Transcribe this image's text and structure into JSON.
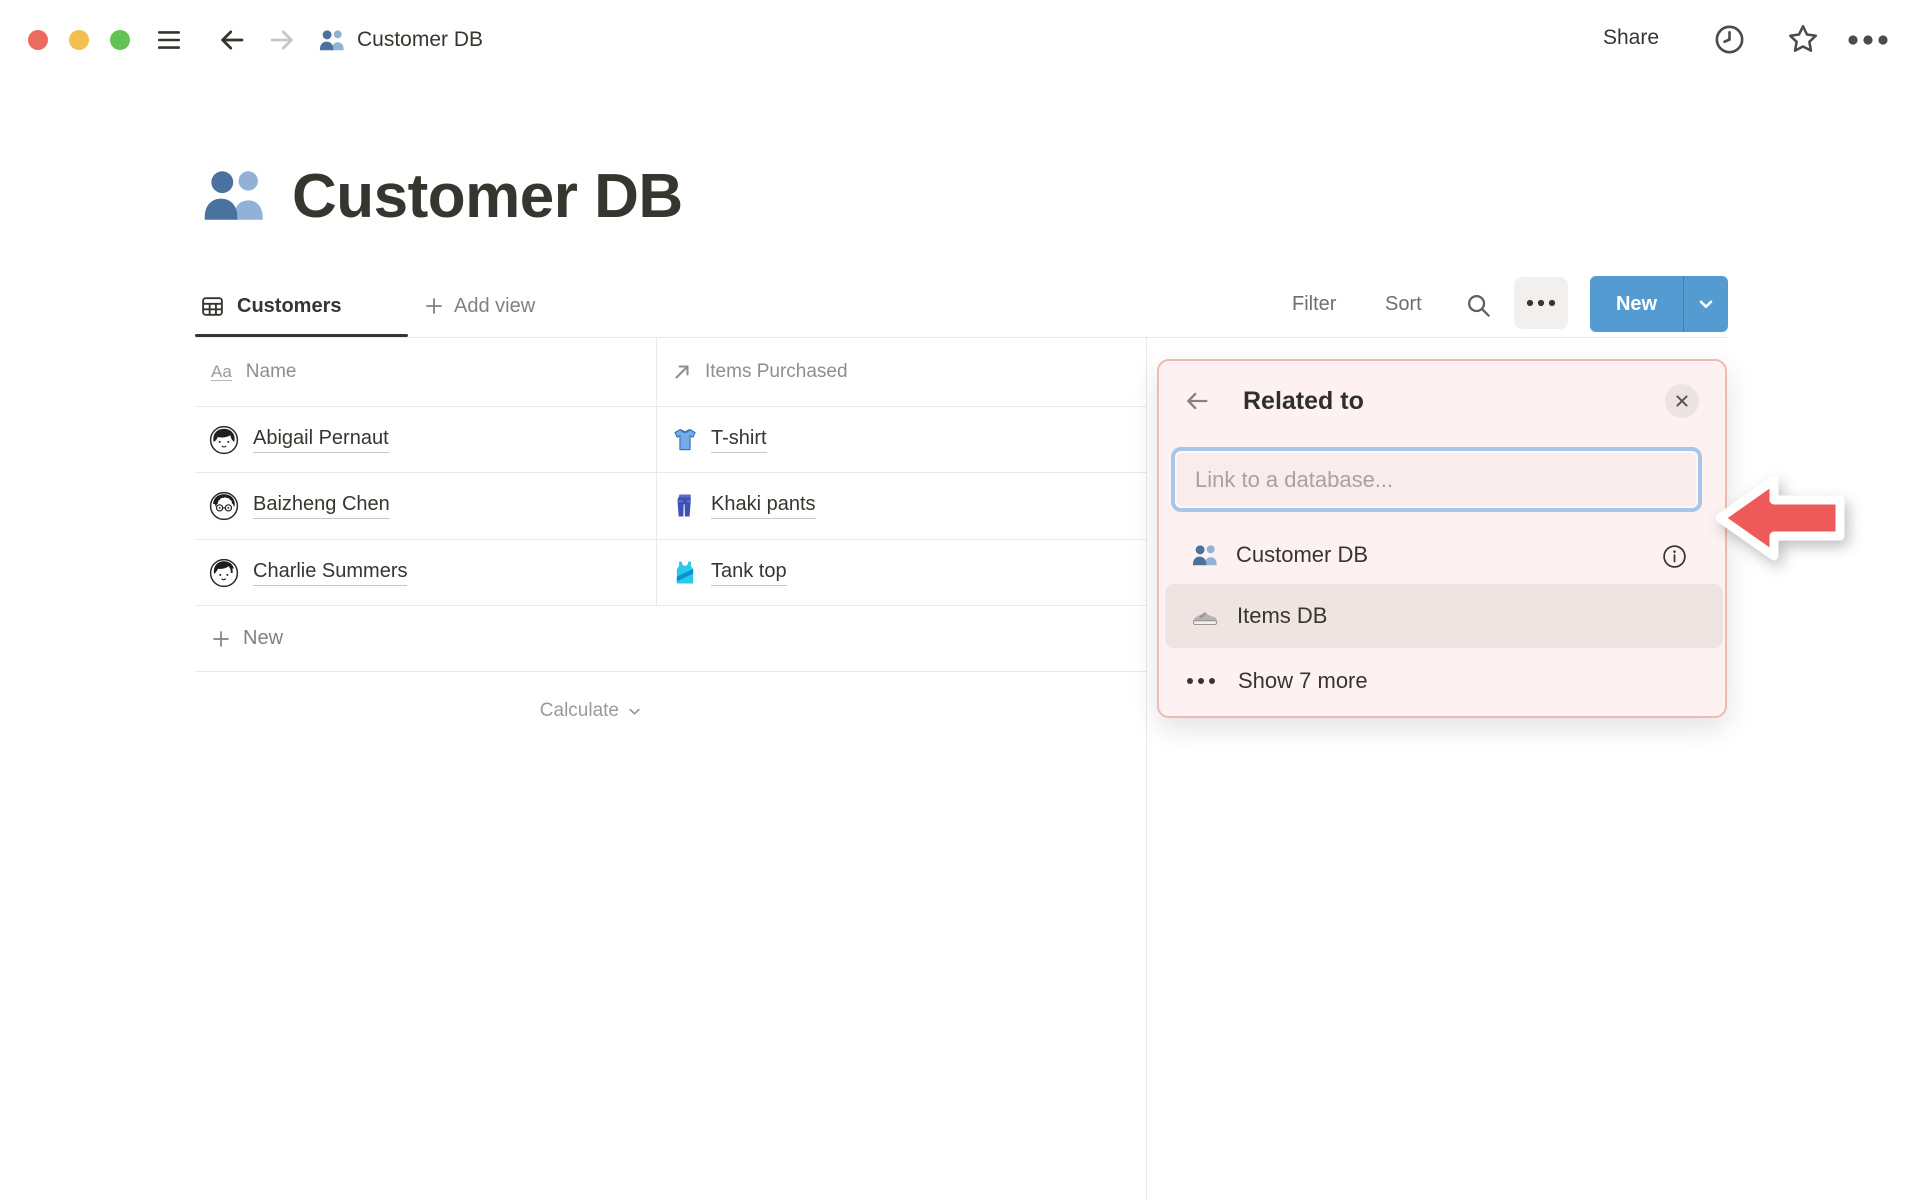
{
  "topbar": {
    "doc_title": "Customer DB",
    "share": "Share"
  },
  "page": {
    "title": "Customer DB"
  },
  "toolbar": {
    "active_view": "Customers",
    "add_view": "Add view",
    "filter": "Filter",
    "sort": "Sort",
    "new": "New"
  },
  "table": {
    "columns": {
      "name": "Name",
      "items": "Items Purchased"
    },
    "rows": [
      {
        "name": "Abigail Pernaut",
        "item": "T-shirt"
      },
      {
        "name": "Baizheng Chen",
        "item": "Khaki pants"
      },
      {
        "name": "Charlie Summers",
        "item": "Tank top"
      }
    ],
    "new_row": "New",
    "calculate": "Calculate"
  },
  "popup": {
    "title": "Related to",
    "placeholder": "Link to a database...",
    "options": [
      {
        "label": "Customer DB",
        "icon": "people-icon",
        "highlighted": false
      },
      {
        "label": "Items DB",
        "icon": "sneaker-icon",
        "highlighted": true
      }
    ],
    "show_more": "Show 7 more"
  },
  "colors": {
    "traffic_red": "#ec6a5e",
    "traffic_yellow": "#f4bf4f",
    "traffic_green": "#61c454",
    "accent_blue_button": "#549bd2",
    "popup_background": "#fdf2f1",
    "popup_border": "#f2b8b4",
    "focus_ring_blue": "#a6c7e7",
    "row_highlight": "#f0e4e2",
    "tutorial_arrow_red": "#ee5a5a",
    "divider_gray": "#e9e9e7",
    "text_dark": "#37352f",
    "text_gray": "#82817e"
  }
}
